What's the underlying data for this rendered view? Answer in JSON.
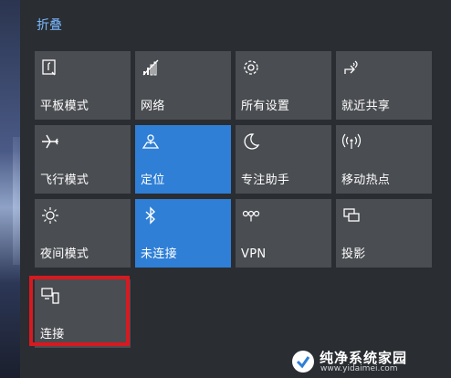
{
  "header": {
    "collapse_label": "折叠"
  },
  "tiles": [
    {
      "label": "平板模式",
      "icon": "tablet-mode-icon",
      "active": false
    },
    {
      "label": "网络",
      "icon": "network-icon",
      "active": false
    },
    {
      "label": "所有设置",
      "icon": "gear-icon",
      "active": false
    },
    {
      "label": "就近共享",
      "icon": "nearby-share-icon",
      "active": false
    },
    {
      "label": "飞行模式",
      "icon": "airplane-icon",
      "active": false
    },
    {
      "label": "定位",
      "icon": "location-icon",
      "active": true
    },
    {
      "label": "专注助手",
      "icon": "moon-icon",
      "active": false
    },
    {
      "label": "移动热点",
      "icon": "hotspot-icon",
      "active": false
    },
    {
      "label": "夜间模式",
      "icon": "brightness-icon",
      "active": false
    },
    {
      "label": "未连接",
      "icon": "bluetooth-icon",
      "active": true
    },
    {
      "label": "VPN",
      "icon": "vpn-icon",
      "active": false
    },
    {
      "label": "投影",
      "icon": "project-icon",
      "active": false
    },
    {
      "label": "连接",
      "icon": "connect-icon",
      "active": false
    }
  ],
  "colors": {
    "accent": "#2f7fd6",
    "tile": "#4a4d51",
    "highlight": "#d71920",
    "link": "#78b7ff"
  },
  "watermark": {
    "title": "纯净系统家园",
    "url": "www.yidaimei.com"
  }
}
